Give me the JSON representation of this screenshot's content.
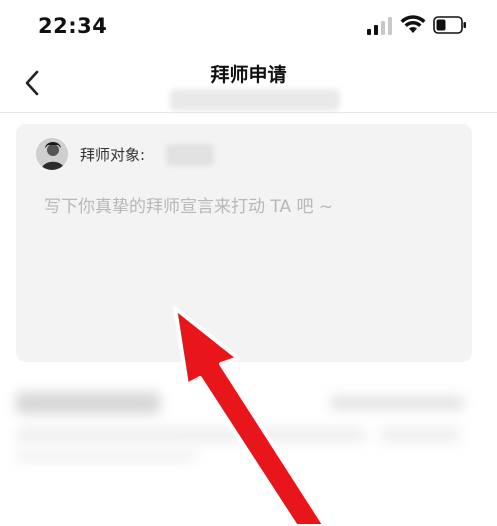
{
  "status_bar": {
    "time": "22:34",
    "signal_icon": "cellular-signal-icon",
    "wifi_icon": "wifi-icon",
    "battery_icon": "battery-icon"
  },
  "nav": {
    "back_icon": "chevron-left-icon",
    "title": "拜师申请"
  },
  "form": {
    "target_label": "拜师对象:",
    "declaration_placeholder": "写下你真挚的拜师宣言来打动 TA 吧 ~"
  },
  "annotation": {
    "icon": "red-arrow-icon",
    "color": "#e8161b"
  }
}
